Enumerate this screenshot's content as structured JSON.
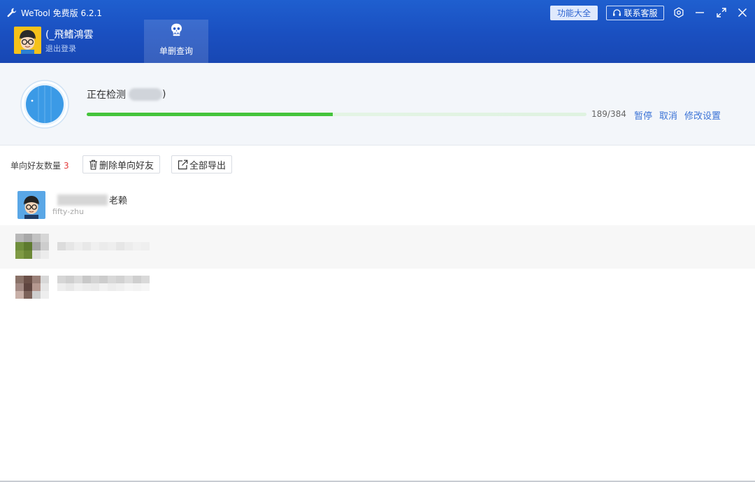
{
  "app": {
    "title": "WeTool 免费版 6.2.1",
    "colors": {
      "header": "#1a4fc0",
      "accent": "#3b73d6",
      "progress": "#45c43b",
      "count": "#e33a3a"
    }
  },
  "user": {
    "name": "(_飛鰭鴻雲",
    "logout": "退出登录",
    "avatar_icon": "cartoon-avatar-icon"
  },
  "tabs": [
    {
      "label": "单删查询",
      "icon": "skull-icon"
    }
  ],
  "header_buttons": {
    "features": "功能大全",
    "support": "联系客服"
  },
  "window_controls": [
    "settings-icon",
    "minimize-icon",
    "maximize-icon",
    "close-icon"
  ],
  "scan": {
    "status_prefix": "正在检测",
    "status_suffix": ")",
    "progress_done": 189,
    "progress_total": 384,
    "progress_text": "189/384",
    "actions": {
      "pause": "暂停",
      "cancel": "取消",
      "settings": "修改设置"
    }
  },
  "toolbar": {
    "count_label": "单向好友数量",
    "count_value": "3",
    "delete_button": "删除单向好友",
    "export_button": "全部导出"
  },
  "friends": [
    {
      "name_suffix": "老赖",
      "wechat_id": "fifty-zhu"
    },
    {
      "name_suffix": "",
      "wechat_id": ""
    },
    {
      "name_suffix": "",
      "wechat_id": ""
    }
  ]
}
